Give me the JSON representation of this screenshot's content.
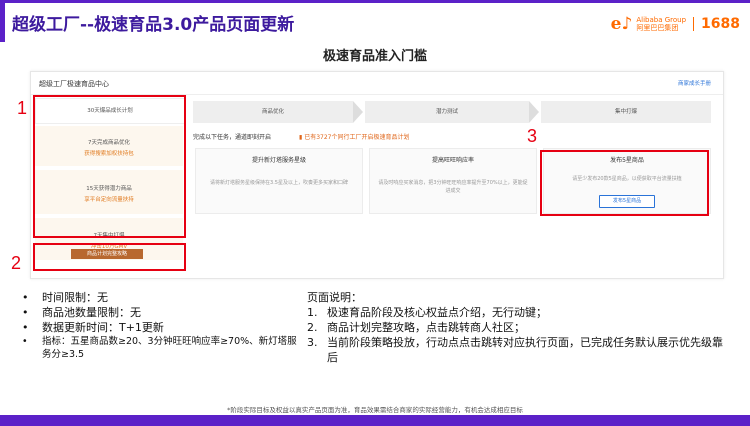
{
  "slide": {
    "title": "超级工厂--极速育品3.0产品页面更新",
    "subtitle": "极速育品准入门槛",
    "footnote": "*阶段实际目标及权益以真实产品页面为准，育品效果需结合商家的实际经营能力，有机会达成相应目标",
    "colors": {
      "accent": "#5b21c8",
      "highlight": "#e60012",
      "brand": "#ff6a00"
    }
  },
  "logo": {
    "line1": "Alibaba Group",
    "line2": "阿里巴巴集团",
    "brand": "1688"
  },
  "screenshot": {
    "header_title": "超级工厂极速育品中心",
    "header_link": "商家成长手册",
    "sidebar": {
      "item1": {
        "label": "30天爆品成长计划"
      },
      "item2": {
        "label": "7天完成商品优化",
        "sub": "获得搜索加权扶持包"
      },
      "item3": {
        "label": "15天获得潜力商品",
        "sub": "享平台定向流量扶持"
      },
      "item4": {
        "label": "7天集中打爆",
        "sub": "冲击10万GMV"
      },
      "button": "商品计划完整攻略"
    },
    "steps": [
      "商品优化",
      "潜力测试",
      "集中打爆"
    ],
    "task_text": "完成以下任务，通道即刻开启",
    "task_hint": "已有3727个同行工厂开启极速育品计划",
    "cards": [
      {
        "title": "提升新灯塔服务星级",
        "desc": "请将新灯塔服务星级保持在3.5星及以上，吹奏更多买家和口碑"
      },
      {
        "title": "提高旺旺响应率",
        "desc": "请及时响应买家消息，把3分钟旺旺响应率提升至70%以上，更能促进成交"
      },
      {
        "title": "发布5星商品",
        "desc": "请至少发布20款5星商品，以便获取平台流量扶植",
        "button": "发布5星商品"
      }
    ]
  },
  "markers": {
    "m1": "1",
    "m2": "2",
    "m3": "3"
  },
  "bullets": [
    "时间限制：无",
    "商品池数量限制：无",
    "数据更新时间：T+1更新",
    "指标：五星商品数≥20、3分钟旺旺响应率≥70%、新灯塔服务分≥3.5"
  ],
  "page_desc": {
    "title": "页面说明：",
    "items": [
      "极速育品阶段及核心权益点介绍，无行动键；",
      "商品计划完整攻略，点击跳转商人社区；",
      "当前阶段策略投放，行动点点击跳转对应执行页面，已完成任务默认展示优先级靠后"
    ],
    "numbers": [
      "1.",
      "2.",
      "3."
    ]
  }
}
